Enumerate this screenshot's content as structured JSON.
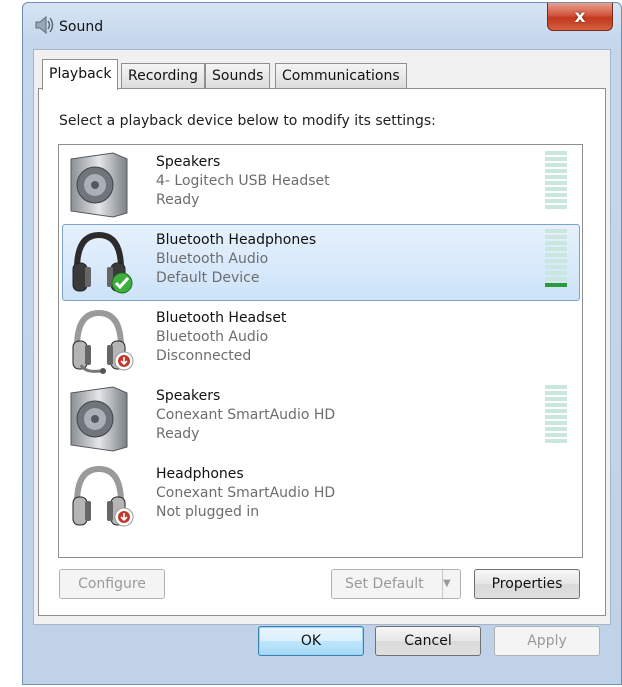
{
  "window": {
    "title": "Sound",
    "close_label": "x"
  },
  "tabs": [
    {
      "label": "Playback",
      "active": true
    },
    {
      "label": "Recording",
      "active": false
    },
    {
      "label": "Sounds",
      "active": false
    },
    {
      "label": "Communications",
      "active": false
    }
  ],
  "instruction": "Select a playback device below to modify its settings:",
  "devices": [
    {
      "name": "Speakers",
      "description": "4- Logitech USB Headset",
      "status": "Ready",
      "icon": "speaker-icon",
      "badge": "",
      "meter": true,
      "level": 0,
      "selected": false
    },
    {
      "name": "Bluetooth Headphones",
      "description": "Bluetooth Audio",
      "status": "Default Device",
      "icon": "headphones-icon",
      "badge": "default-check-icon",
      "meter": true,
      "level": 0.1,
      "selected": true
    },
    {
      "name": "Bluetooth Headset",
      "description": "Bluetooth Audio",
      "status": "Disconnected",
      "icon": "headset-icon",
      "badge": "disconnected-icon",
      "meter": false,
      "level": 0,
      "selected": false
    },
    {
      "name": "Speakers",
      "description": "Conexant SmartAudio HD",
      "status": "Ready",
      "icon": "speaker-icon",
      "badge": "",
      "meter": true,
      "level": 0,
      "selected": false
    },
    {
      "name": "Headphones",
      "description": "Conexant SmartAudio HD",
      "status": "Not plugged in",
      "icon": "headphones-icon",
      "badge": "unplugged-icon",
      "meter": false,
      "level": 0,
      "selected": false
    }
  ],
  "buttons": {
    "configure": "Configure",
    "set_default": "Set Default",
    "properties": "Properties",
    "ok": "OK",
    "cancel": "Cancel",
    "apply": "Apply"
  },
  "colors": {
    "selection": "#cde3f9",
    "meter_idle": "#c9e6df",
    "meter_active": "#2e9b3a",
    "check_badge": "#3fae3f",
    "red_badge": "#c0392b"
  }
}
